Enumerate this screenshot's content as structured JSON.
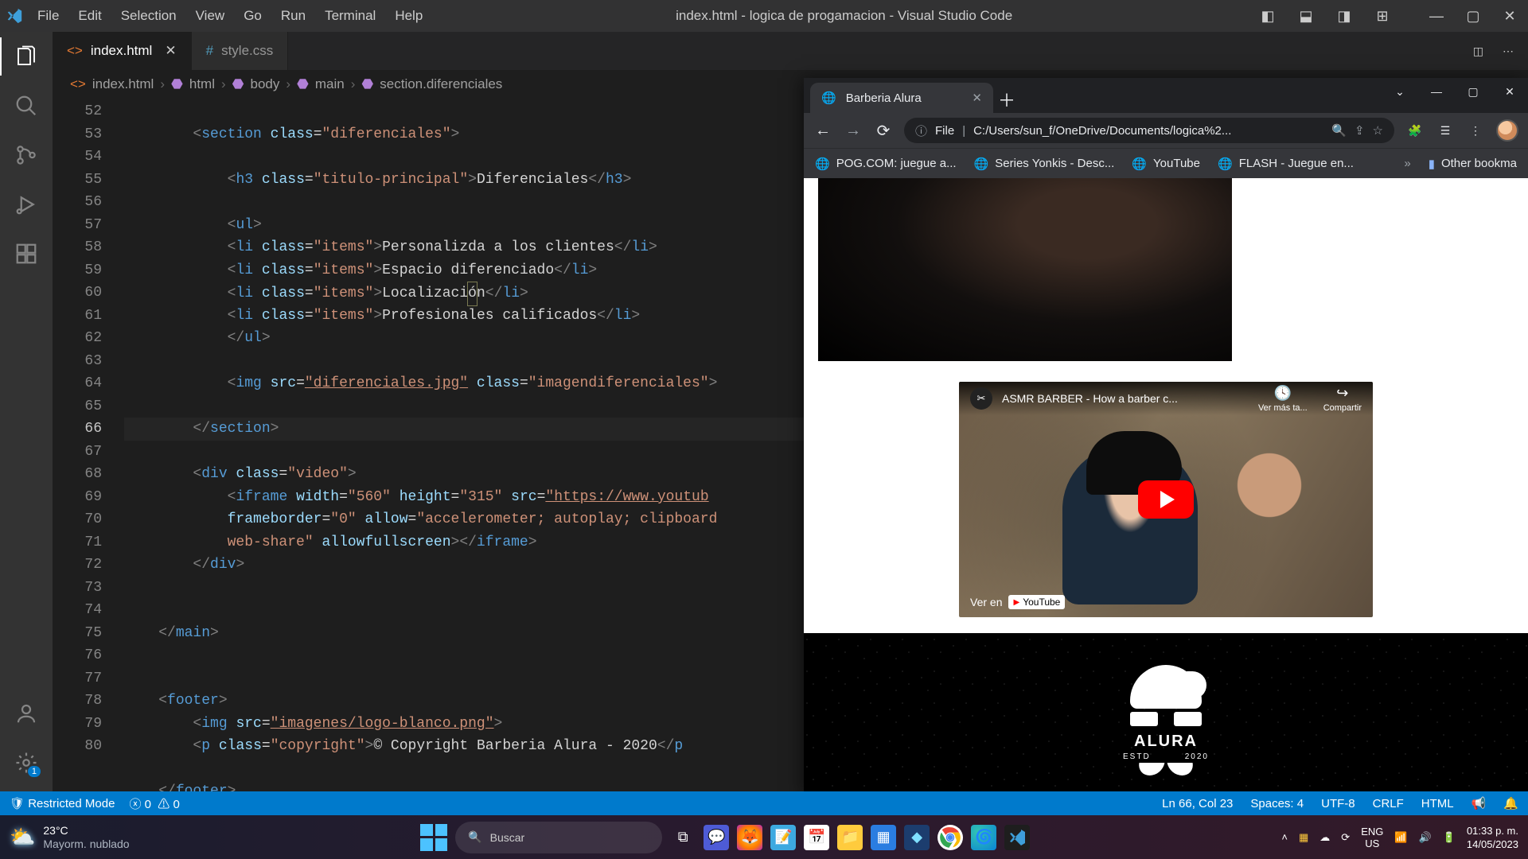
{
  "titlebar": {
    "menu": [
      "File",
      "Edit",
      "Selection",
      "View",
      "Go",
      "Run",
      "Terminal",
      "Help"
    ],
    "title": "index.html - logica de progamacion - Visual Studio Code"
  },
  "tabs": [
    {
      "icon": "html",
      "label": "index.html",
      "active": true,
      "dirty": false
    },
    {
      "icon": "css",
      "label": "style.css",
      "active": false,
      "dirty": false
    }
  ],
  "breadcrumb": {
    "file": "index.html",
    "path": [
      "html",
      "body",
      "main",
      "section.diferenciales"
    ]
  },
  "gutter": {
    "start": 52,
    "end": 80,
    "active": 66
  },
  "code": {
    "l53": {
      "tag": "section",
      "attr": "class",
      "val": "diferenciales"
    },
    "l55": {
      "tag": "h3",
      "attr": "class",
      "val": "titulo-principal",
      "txt": "Diferenciales"
    },
    "l57": {
      "tag": "ul"
    },
    "l58": {
      "tag": "li",
      "attr": "class",
      "val": "items",
      "txt": "Personalizda a los clientes"
    },
    "l59": {
      "tag": "li",
      "attr": "class",
      "val": "items",
      "txt": "Espacio diferenciado"
    },
    "l60": {
      "tag": "li",
      "attr": "class",
      "val": "items",
      "txt": "Localización"
    },
    "l61": {
      "tag": "li",
      "attr": "class",
      "val": "items",
      "txt": "Profesionales calificados"
    },
    "l62": {
      "tag": "ul",
      "close": true
    },
    "l64": {
      "tag": "img",
      "src": "diferenciales.jpg",
      "cls": "imagendiferenciales"
    },
    "l66": {
      "tag": "section",
      "close": true
    },
    "l68": {
      "tag": "div",
      "attr": "class",
      "val": "video"
    },
    "l69a": {
      "tag": "iframe",
      "width": "560",
      "height": "315",
      "src": "https://www.youtub"
    },
    "l69b": {
      "frameborder": "0",
      "allow": "accelerometer; autoplay; clipboard"
    },
    "l69c": {
      "txt": "web-share",
      "allowfull": "allowfullscreen",
      "tag": "iframe"
    },
    "l70": {
      "tag": "div",
      "close": true
    },
    "l73": {
      "tag": "main",
      "close": true
    },
    "l76": {
      "tag": "footer"
    },
    "l77": {
      "tag": "img",
      "src": "imagenes/logo-blanco.png"
    },
    "l78": {
      "tag": "p",
      "attr": "class",
      "val": "copyright",
      "txt": "&copy Copyright Barberia Alura - 2020"
    },
    "l80": {
      "tag": "footer",
      "close": true
    }
  },
  "browser": {
    "tab_title": "Barberia Alura",
    "url_label": "File",
    "url": "C:/Users/sun_f/OneDrive/Documents/logica%2...",
    "bookmarks": [
      "POG.COM: juegue a...",
      "Series Yonkis - Desc...",
      "YouTube",
      "FLASH - Juegue en..."
    ],
    "other_bookmarks": "Other bookma",
    "yt_title": "ASMR BARBER - How a barber c...",
    "yt_later": "Ver más ta...",
    "yt_share": "Compartir",
    "watch_on": "Ver en",
    "yt_brand": "YouTube",
    "logo_name": "ALURA",
    "logo_estd": "ESTD",
    "logo_year": "2020"
  },
  "statusbar": {
    "restricted": "Restricted Mode",
    "errors": "0",
    "warnings": "0",
    "pos": "Ln 66, Col 23",
    "spaces": "Spaces: 4",
    "encoding": "UTF-8",
    "eol": "CRLF",
    "lang": "HTML"
  },
  "taskbar": {
    "temp": "23°C",
    "weather": "Mayorm. nublado",
    "search_placeholder": "Buscar",
    "lang1": "ENG",
    "lang2": "US",
    "time": "01:33 p. m.",
    "date": "14/05/2023"
  },
  "activity_badge": "1"
}
